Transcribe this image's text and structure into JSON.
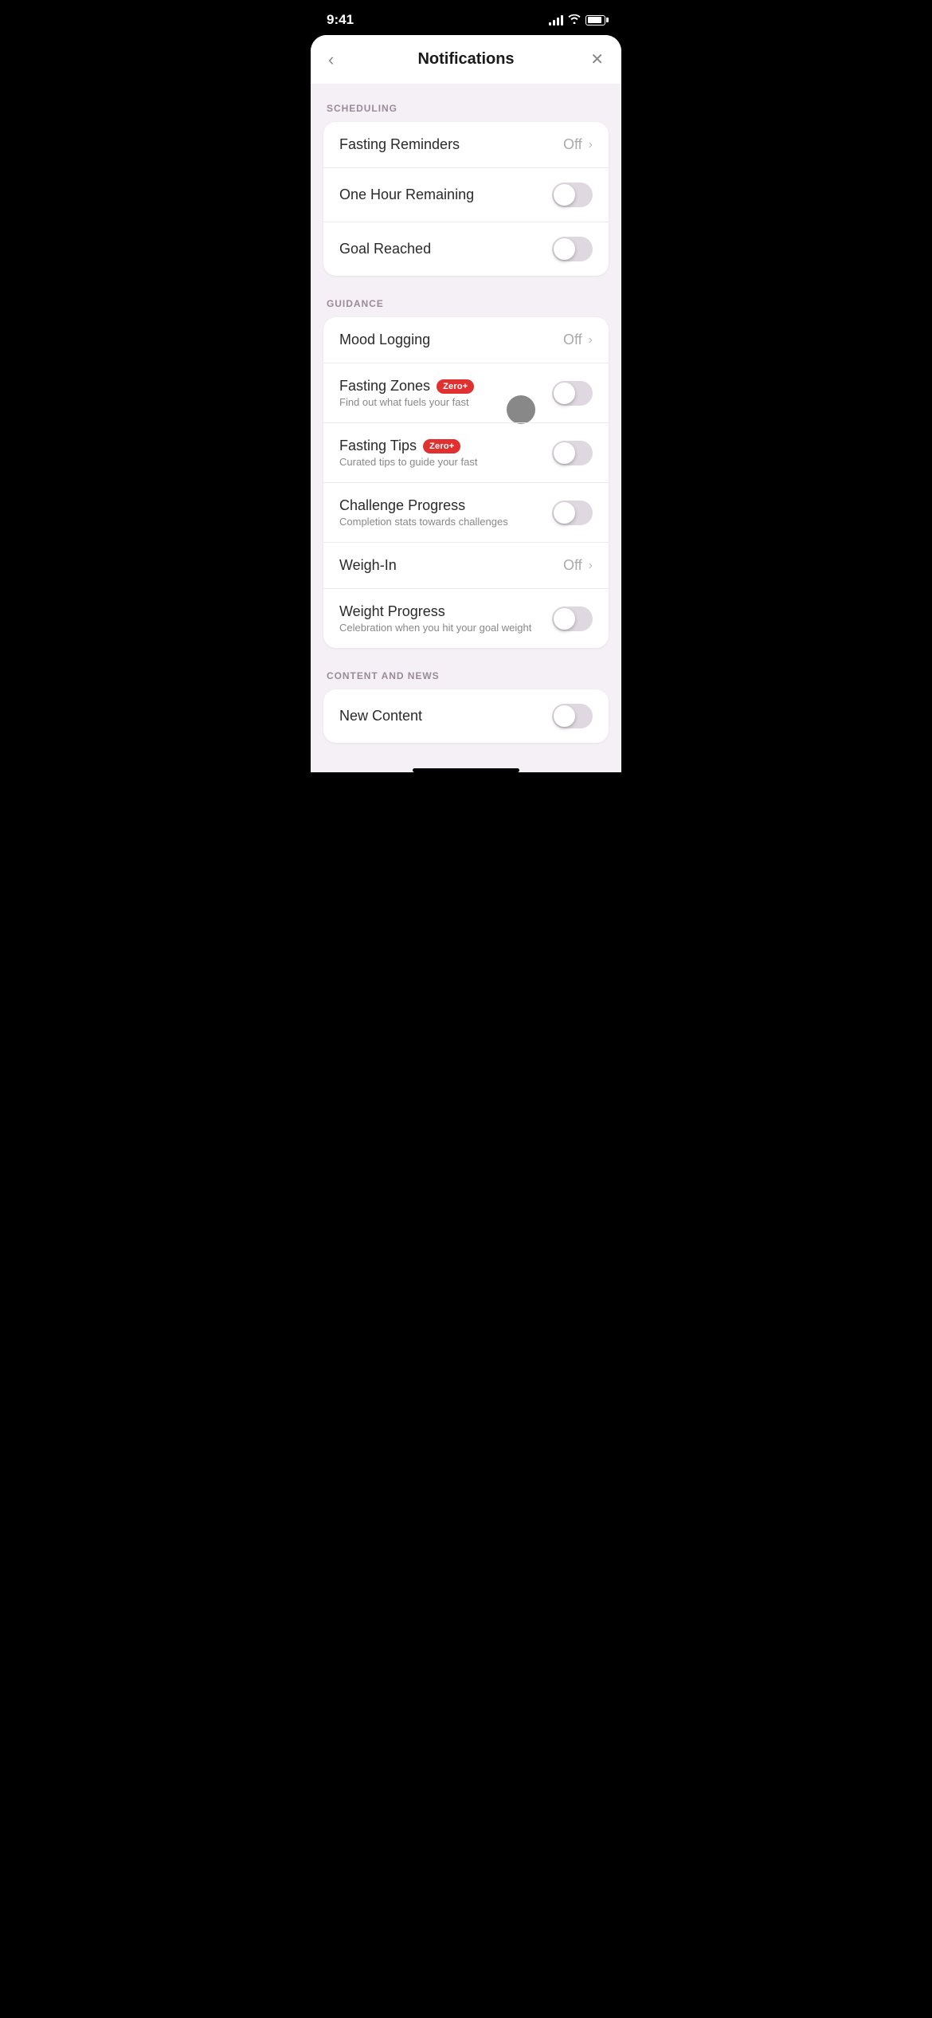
{
  "statusBar": {
    "time": "9:41"
  },
  "header": {
    "title": "Notifications",
    "backLabel": "‹",
    "closeLabel": "✕"
  },
  "sections": [
    {
      "id": "scheduling",
      "label": "SCHEDULING",
      "rows": [
        {
          "id": "fasting-reminders",
          "title": "Fasting Reminders",
          "type": "link",
          "value": "Off",
          "toggle": null,
          "badge": null,
          "subtitle": null
        },
        {
          "id": "one-hour-remaining",
          "title": "One Hour Remaining",
          "type": "toggle",
          "value": null,
          "toggleOn": false,
          "badge": null,
          "subtitle": null
        },
        {
          "id": "goal-reached",
          "title": "Goal Reached",
          "type": "toggle",
          "value": null,
          "toggleOn": false,
          "badge": null,
          "subtitle": null
        }
      ]
    },
    {
      "id": "guidance",
      "label": "GUIDANCE",
      "rows": [
        {
          "id": "mood-logging",
          "title": "Mood Logging",
          "type": "link",
          "value": "Off",
          "toggleOn": false,
          "badge": null,
          "subtitle": null
        },
        {
          "id": "fasting-zones",
          "title": "Fasting Zones",
          "type": "toggle-tooltip",
          "value": null,
          "toggleOn": false,
          "badge": "Zero+",
          "subtitle": "Find out what fuels your fast"
        },
        {
          "id": "fasting-tips",
          "title": "Fasting Tips",
          "type": "toggle",
          "value": null,
          "toggleOn": false,
          "badge": "Zero+",
          "subtitle": "Curated tips to guide your fast"
        },
        {
          "id": "challenge-progress",
          "title": "Challenge Progress",
          "type": "toggle",
          "value": null,
          "toggleOn": false,
          "badge": null,
          "subtitle": "Completion stats towards challenges"
        },
        {
          "id": "weigh-in",
          "title": "Weigh-In",
          "type": "link",
          "value": "Off",
          "toggleOn": false,
          "badge": null,
          "subtitle": null
        },
        {
          "id": "weight-progress",
          "title": "Weight Progress",
          "type": "toggle",
          "value": null,
          "toggleOn": false,
          "badge": null,
          "subtitle": "Celebration when you hit your goal weight"
        }
      ]
    },
    {
      "id": "content-and-news",
      "label": "CONTENT AND NEWS",
      "rows": [
        {
          "id": "new-content",
          "title": "New Content",
          "type": "toggle",
          "value": null,
          "toggleOn": false,
          "badge": null,
          "subtitle": null
        }
      ]
    }
  ]
}
